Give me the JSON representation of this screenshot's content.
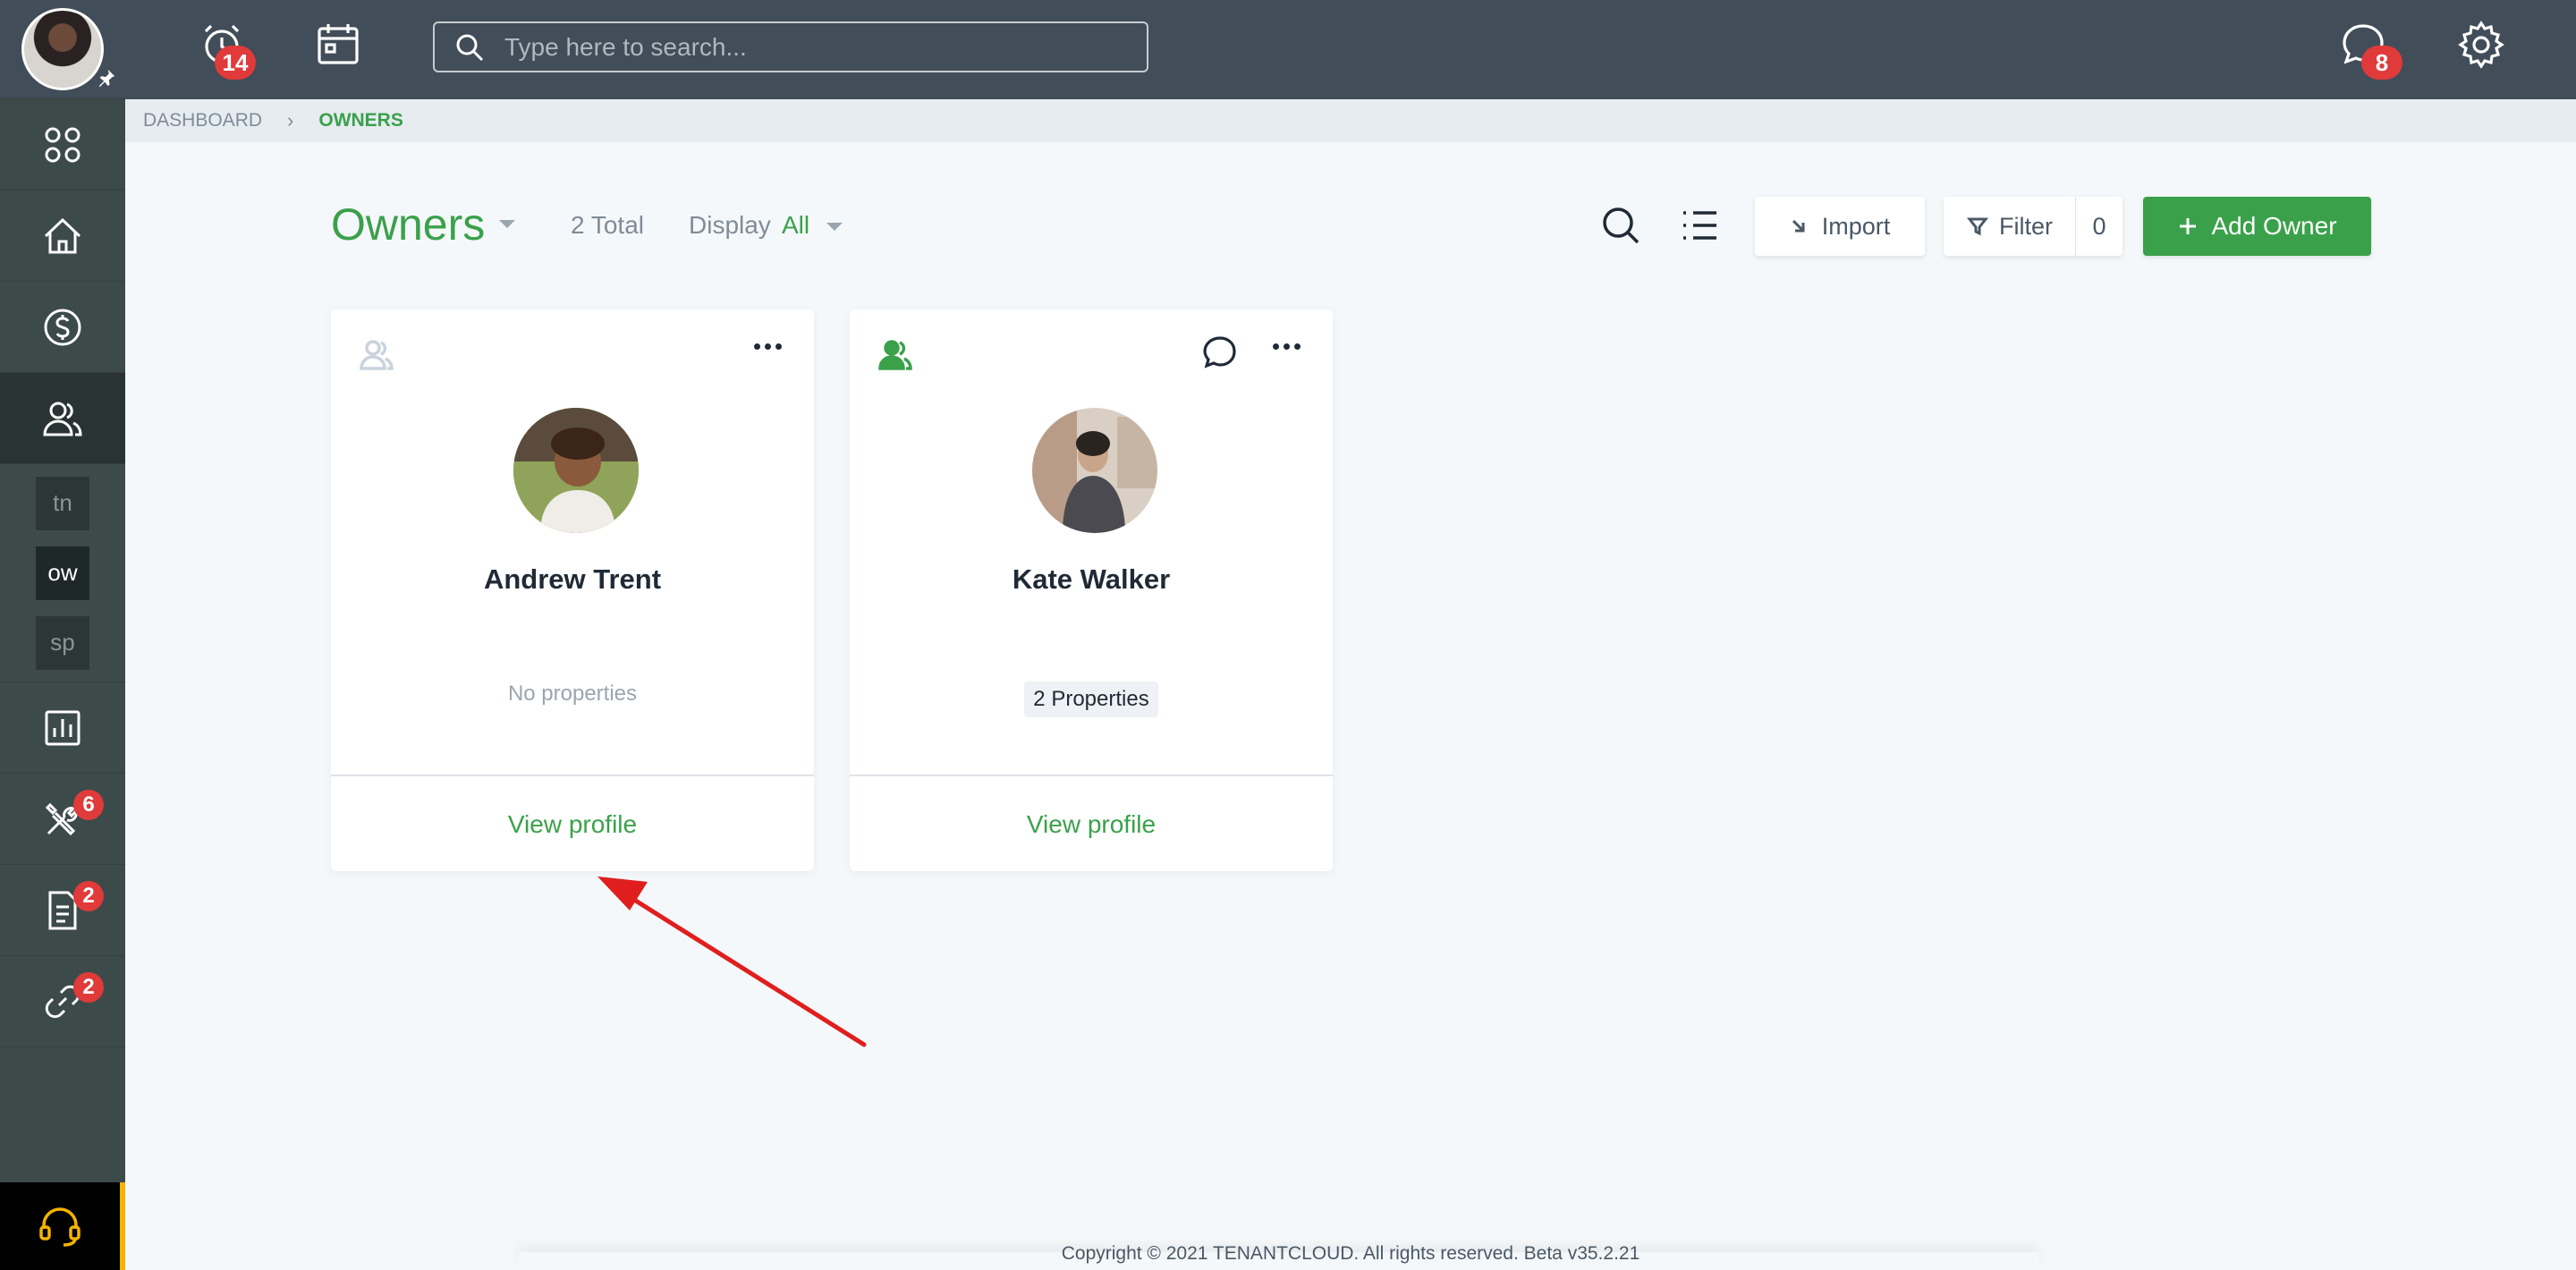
{
  "topbar": {
    "alarm_badge": "14",
    "search_placeholder": "Type here to search...",
    "chat_badge": "8"
  },
  "sidebar": {
    "abbrs": [
      "tn",
      "ow",
      "sp"
    ],
    "maintenance_badge": "6",
    "documents_badge": "2",
    "links_badge": "2"
  },
  "breadcrumb": {
    "root": "DASHBOARD",
    "current": "OWNERS"
  },
  "header": {
    "title": "Owners",
    "total": "2 Total",
    "display_label": "Display",
    "display_value": "All",
    "import_label": "Import",
    "filter_label": "Filter",
    "filter_count": "0",
    "add_label": "Add Owner"
  },
  "owners": [
    {
      "name": "Andrew Trent",
      "properties": "No properties",
      "link": "View profile"
    },
    {
      "name": "Kate Walker",
      "properties": "2 Properties",
      "link": "View profile"
    }
  ],
  "footer": {
    "copyright": "Copyright © 2021 TENANTCLOUD. All rights reserved. Beta v35.2.21"
  },
  "colors": {
    "accent": "#3aa14a",
    "topbar": "#414d58",
    "sidebar": "#3d4a4a",
    "badge": "#e03a3a",
    "annotation_arrow": "#e01e1e"
  }
}
